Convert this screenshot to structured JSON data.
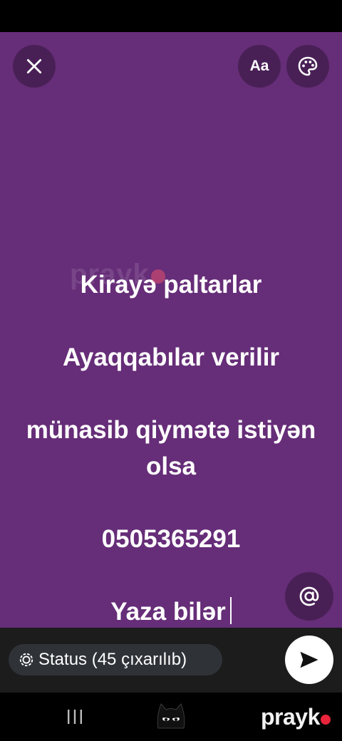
{
  "toolbar": {
    "font_button_label": "Aa"
  },
  "status_text": {
    "lines": [
      "Kirayə paltarlar",
      "Ayaqqabılar verilir",
      "münasib qiymətə istiyən olsa",
      "0505365291",
      "Yaza bilər"
    ]
  },
  "watermark": {
    "text": "prayk"
  },
  "bottom": {
    "audience_label": "Status (45 çıxarılıb)"
  },
  "navbar": {
    "brand": "prayk"
  },
  "colors": {
    "background": "#662d78",
    "bottom_bar": "#1c1c1c",
    "send_button": "#ffffff",
    "brand_dot": "#e8253a"
  },
  "icons": [
    "close-icon",
    "palette-icon",
    "at-sign-icon",
    "send-icon",
    "status-ring-icon",
    "recent-apps-icon",
    "mascot-icon"
  ]
}
